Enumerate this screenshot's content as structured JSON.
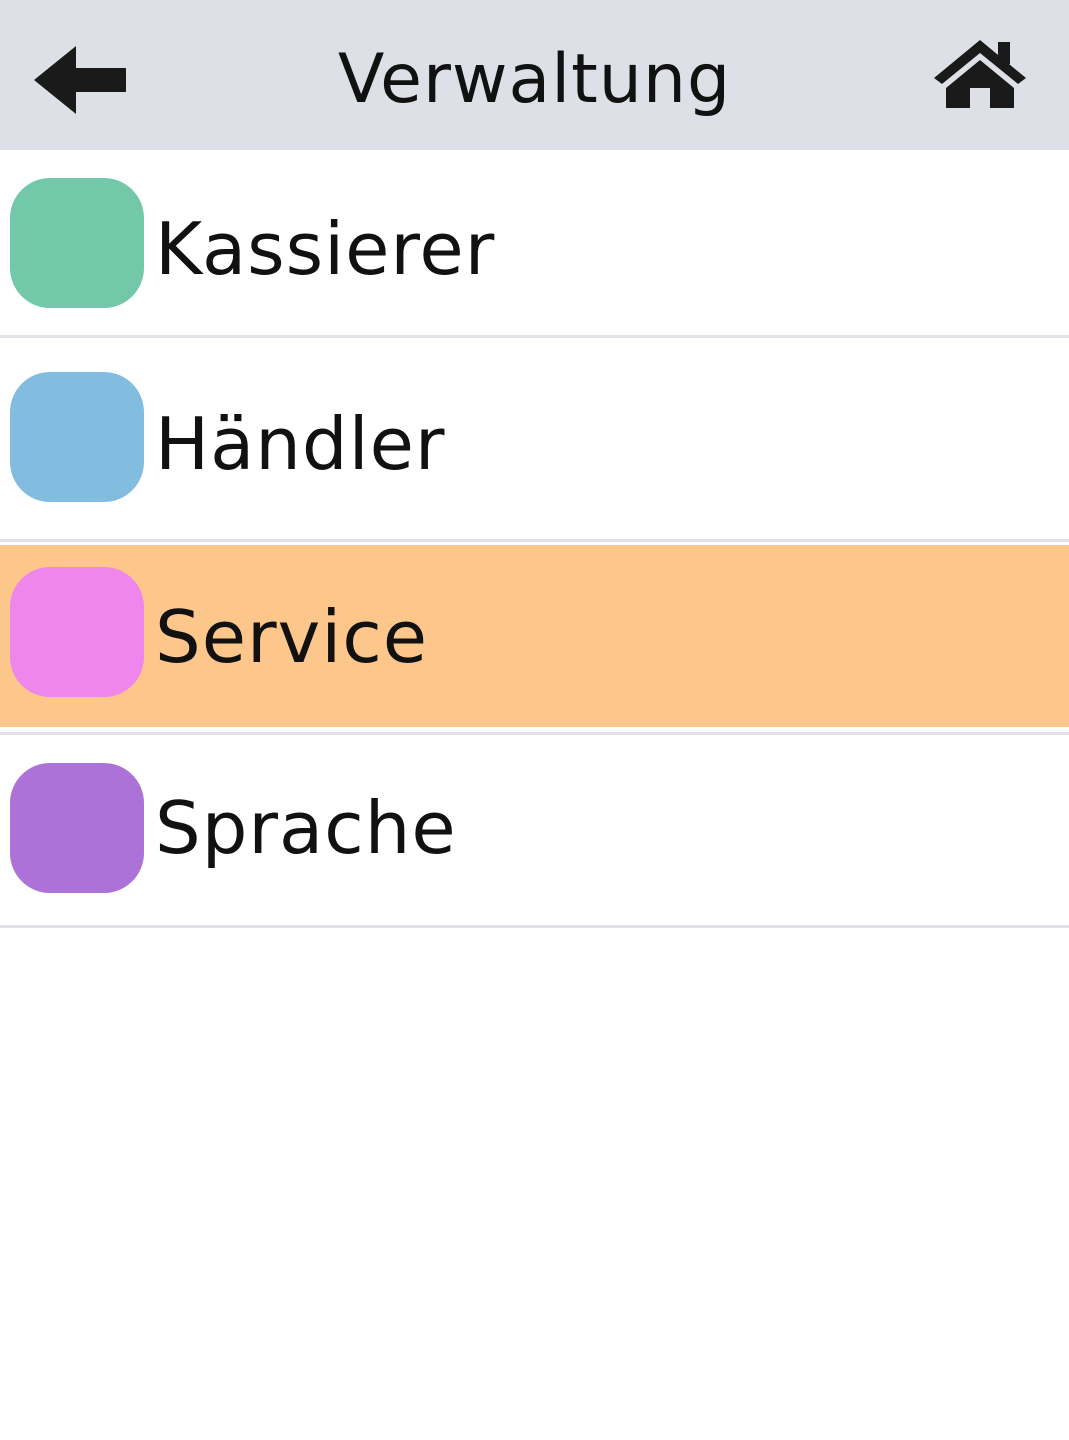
{
  "header": {
    "title": "Verwaltung",
    "back_icon": "arrow-left-icon",
    "home_icon": "home-icon",
    "background": "#dde1e7"
  },
  "menu": {
    "items": [
      {
        "label": "Kassierer",
        "color": "#72c8a9",
        "selected": false
      },
      {
        "label": "Händler",
        "color": "#82bddf",
        "selected": false
      },
      {
        "label": "Service",
        "color": "#ee86ec",
        "selected": true
      },
      {
        "label": "Sprache",
        "color": "#ad72d8",
        "selected": false
      }
    ],
    "selected_background": "#fdc78c"
  }
}
